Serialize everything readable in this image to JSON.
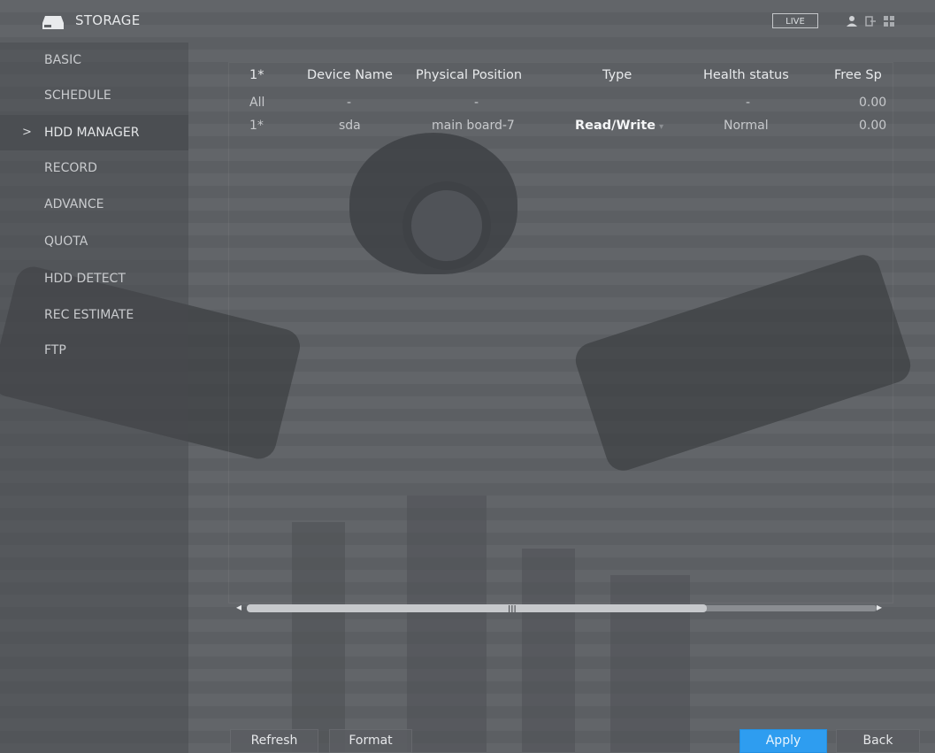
{
  "header": {
    "title": "STORAGE",
    "live_label": "LIVE",
    "icons": [
      "storage-icon",
      "user-icon",
      "logout-icon",
      "grid-icon"
    ]
  },
  "sidebar": {
    "items": [
      {
        "label": "BASIC"
      },
      {
        "label": "SCHEDULE"
      },
      {
        "label": "HDD MANAGER",
        "active": true
      },
      {
        "label": "RECORD"
      },
      {
        "label": "ADVANCE"
      },
      {
        "label": "QUOTA"
      },
      {
        "label": "HDD DETECT"
      },
      {
        "label": "REC ESTIMATE"
      },
      {
        "label": "FTP"
      }
    ],
    "active_marker": ">"
  },
  "table": {
    "headers": [
      "1*",
      "Device Name",
      "Physical Position",
      "Type",
      "Health status",
      "Free Sp"
    ],
    "rows": [
      {
        "id": "All",
        "device_name": "-",
        "physical_position": "-",
        "type": "",
        "health_status": "-",
        "free_space": "0.00"
      },
      {
        "id": "1*",
        "device_name": "sda",
        "physical_position": "main board-7",
        "type": "Read/Write",
        "health_status": "Normal",
        "free_space": "0.00"
      }
    ]
  },
  "scrollbar": {
    "grip": "III",
    "left_arrow": "◂",
    "right_arrow": "▸",
    "thumb_fraction": 0.73
  },
  "footer": {
    "refresh_label": "Refresh",
    "format_label": "Format",
    "apply_label": "Apply",
    "back_label": "Back"
  },
  "colors": {
    "background": "#5f6266",
    "accent": "#2e9df0"
  }
}
